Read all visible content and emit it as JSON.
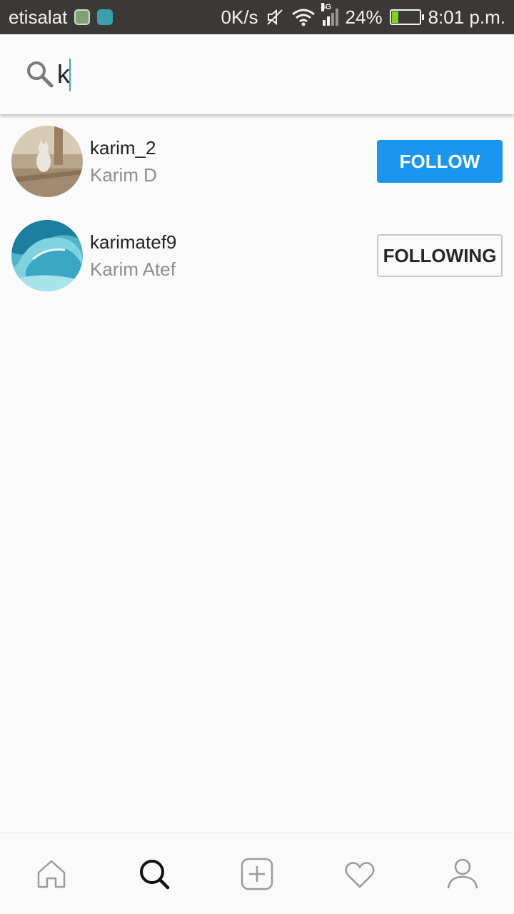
{
  "status_bar": {
    "carrier": "etisalat",
    "net_speed": "0K/s",
    "network_type": "4G",
    "battery": "24%",
    "time": "8:01 p.m."
  },
  "search": {
    "query": "k"
  },
  "results": [
    {
      "username": "karim_2",
      "fullname": "Karim D",
      "button": "FOLLOW",
      "state": "follow",
      "avatar": "cat-photo"
    },
    {
      "username": "karimatef9",
      "fullname": "Karim Atef",
      "button": "FOLLOWING",
      "state": "following",
      "avatar": "wave-photo"
    }
  ],
  "bottom_nav": {
    "items": [
      "home-icon",
      "search-icon",
      "add-icon",
      "heart-icon",
      "profile-icon"
    ],
    "active": "search-icon"
  },
  "colors": {
    "follow_blue": "#1a96f0",
    "status_bar_bg": "#3b3935",
    "caret": "#27b0c2"
  }
}
